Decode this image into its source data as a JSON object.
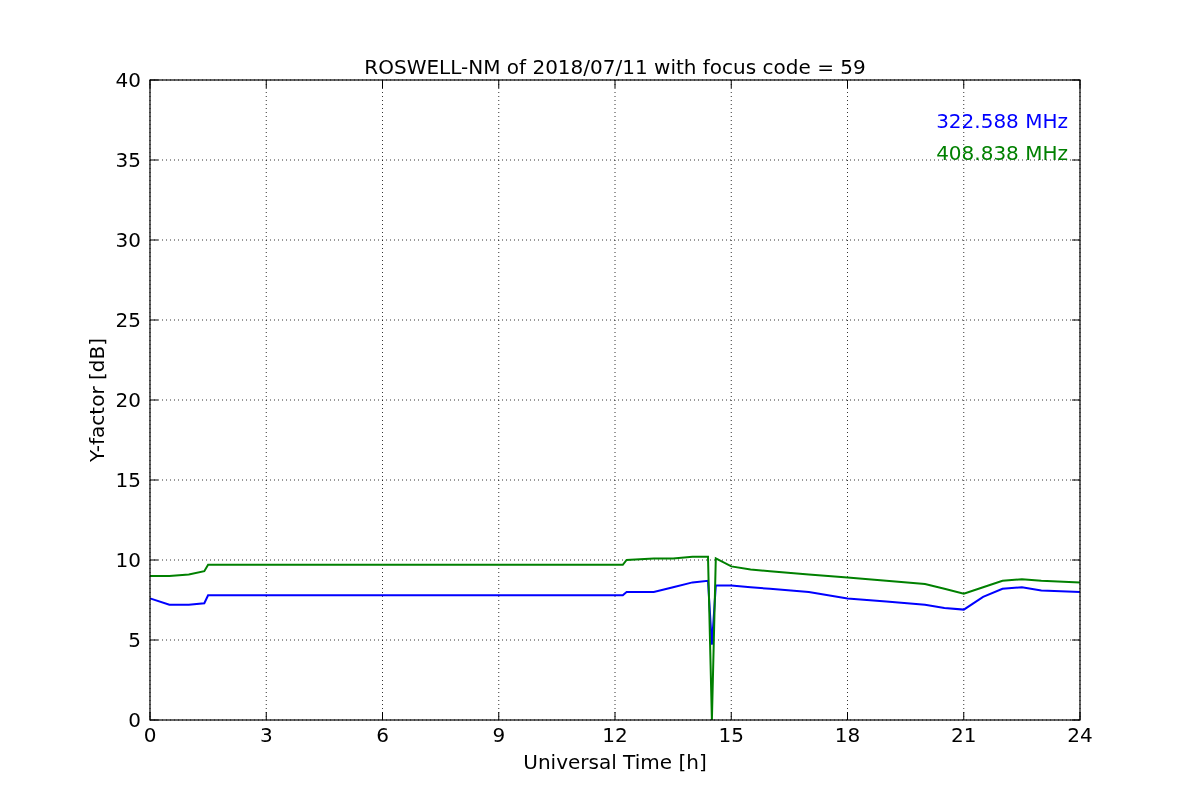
{
  "figure": {
    "chart_data": {
      "type": "line",
      "title": "ROSWELL-NM of 2018/07/11 with focus code = 59",
      "xlabel": "Universal Time [h]",
      "ylabel": "Y-factor [dB]",
      "x": [
        0,
        0.5,
        1,
        1.4,
        1.5,
        3,
        6,
        9,
        12,
        12.2,
        12.3,
        13,
        13.5,
        14,
        14.4,
        14.5,
        14.6,
        15,
        15.5,
        16,
        17,
        18,
        19,
        20,
        20.5,
        21,
        21.5,
        22,
        22.5,
        23,
        24
      ],
      "series": [
        {
          "name": "322.588 MHz",
          "color": "#0000ff",
          "values": [
            7.6,
            7.2,
            7.2,
            7.3,
            7.8,
            7.8,
            7.8,
            7.8,
            7.8,
            7.8,
            8.0,
            8.0,
            8.3,
            8.6,
            8.7,
            4.7,
            8.4,
            8.4,
            8.3,
            8.2,
            8.0,
            7.6,
            7.4,
            7.2,
            7.0,
            6.9,
            7.7,
            8.2,
            8.3,
            8.1,
            8.0
          ]
        },
        {
          "name": "408.838 MHz",
          "color": "#008000",
          "values": [
            9.0,
            9.0,
            9.1,
            9.3,
            9.7,
            9.7,
            9.7,
            9.7,
            9.7,
            9.7,
            10.0,
            10.1,
            10.1,
            10.2,
            10.2,
            0,
            10.1,
            9.6,
            9.4,
            9.3,
            9.1,
            8.9,
            8.7,
            8.5,
            8.2,
            7.9,
            8.3,
            8.7,
            8.8,
            8.7,
            8.6
          ]
        }
      ],
      "xlim": [
        0,
        24
      ],
      "ylim": [
        0,
        40
      ],
      "xticks": [
        0,
        3,
        6,
        9,
        12,
        15,
        18,
        21,
        24
      ],
      "yticks": [
        0,
        5,
        10,
        15,
        20,
        25,
        30,
        35,
        40
      ],
      "grid": true
    }
  }
}
